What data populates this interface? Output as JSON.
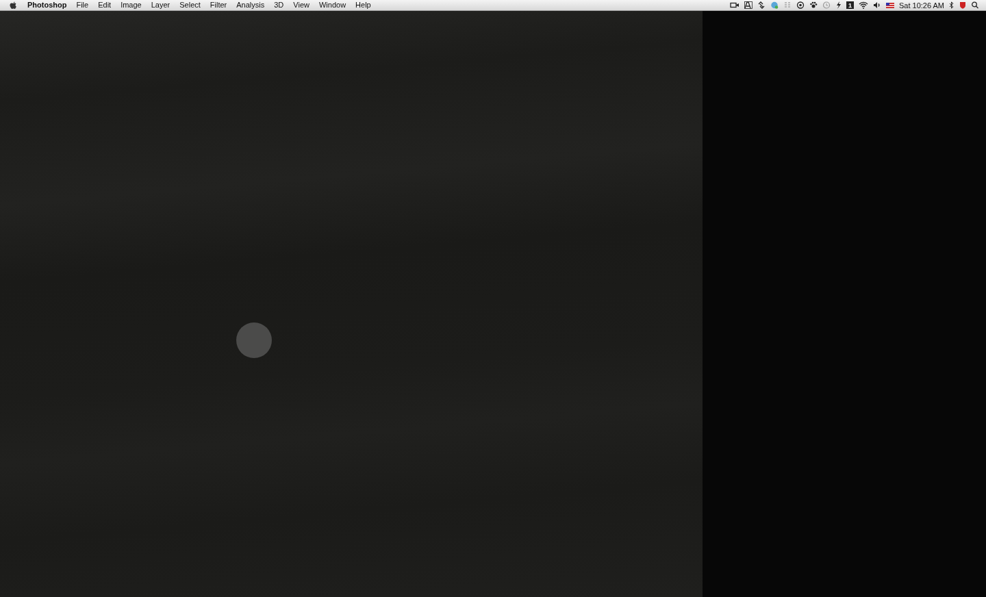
{
  "menu_bar": {
    "menus": [
      {
        "label": "Photoshop",
        "kind": "app"
      },
      {
        "label": "File",
        "kind": "menu"
      },
      {
        "label": "Edit",
        "kind": "menu"
      },
      {
        "label": "Image",
        "kind": "menu"
      },
      {
        "label": "Layer",
        "kind": "menu"
      },
      {
        "label": "Select",
        "kind": "menu"
      },
      {
        "label": "Filter",
        "kind": "menu"
      },
      {
        "label": "Analysis",
        "kind": "menu"
      },
      {
        "label": "3D",
        "kind": "menu"
      },
      {
        "label": "View",
        "kind": "menu"
      },
      {
        "label": "Window",
        "kind": "menu"
      },
      {
        "label": "Help",
        "kind": "menu"
      }
    ],
    "space_badge": "1",
    "clock": "Sat 10:26 AM"
  }
}
